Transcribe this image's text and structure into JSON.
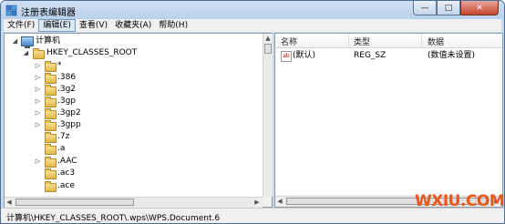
{
  "window": {
    "title": "注册表编辑器",
    "minimize_glyph": "—",
    "maximize_glyph": "□",
    "close_glyph": "✕"
  },
  "menu": [
    "文件(F)",
    "编辑(E)",
    "查看(V)",
    "收藏夹(A)",
    "帮助(H)"
  ],
  "tree": {
    "root": "计算机",
    "hive": "HKEY_CLASSES_ROOT",
    "keys": [
      "*",
      ".386",
      ".3g2",
      ".3gp",
      ".3gp2",
      ".3gpp",
      ".7z",
      ".a",
      ".AAC",
      ".ac3",
      ".ace"
    ]
  },
  "list": {
    "columns": {
      "name": "名称",
      "type": "类型",
      "data": "数据"
    },
    "rows": [
      {
        "icon": "ab",
        "name": "(默认)",
        "type": "REG_SZ",
        "data": "(数值未设置)"
      }
    ]
  },
  "status": {
    "path": "计算机\\HKEY_CLASSES_ROOT\\.wps\\WPS.Document.6"
  },
  "watermark": {
    "text": "WXIU.COM"
  }
}
